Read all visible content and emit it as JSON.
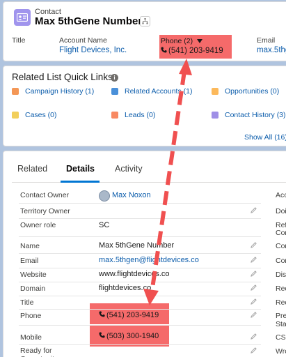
{
  "header": {
    "object_label": "Contact",
    "record_name": "Max 5thGene Number",
    "fields": [
      {
        "label": "Title",
        "value": ""
      },
      {
        "label": "Account Name",
        "value": "Flight Devices, Inc."
      },
      {
        "label": "Phone (2)",
        "value": "(541) 203-9419"
      },
      {
        "label": "Email",
        "value": "max.5thg"
      }
    ]
  },
  "quick_links": {
    "title": "Related List Quick Links",
    "items": [
      {
        "label": "Campaign History (1)",
        "color": "#f49756"
      },
      {
        "label": "Related Accounts (1)",
        "color": "#4a90d9"
      },
      {
        "label": "Opportunities (0)",
        "color": "#fcb95b"
      },
      {
        "label": "Cases (0)",
        "color": "#f2cf5b"
      },
      {
        "label": "Leads (0)",
        "color": "#f88962"
      },
      {
        "label": "Contact History (3)",
        "color": "#9f8fe6"
      }
    ],
    "show_all": "Show All (16)"
  },
  "tabs": [
    "Related",
    "Details",
    "Activity"
  ],
  "details": {
    "rows": [
      {
        "label": "Contact Owner",
        "value": "Max Noxon"
      },
      {
        "label": "Territory Owner",
        "value": ""
      },
      {
        "label": "Owner role",
        "value": "SC"
      },
      {
        "label": "Name",
        "value": "Max 5thGene Number"
      },
      {
        "label": "Email",
        "value": "max.5thgen@flightdevices.co"
      },
      {
        "label": "Website",
        "value": "www.flightdevices.co"
      },
      {
        "label": "Domain",
        "value": "flightdevices.co"
      },
      {
        "label": "Title",
        "value": ""
      },
      {
        "label": "Phone",
        "value": "(541) 203-9419"
      },
      {
        "label": "Mobile",
        "value": "(503) 300-1940"
      },
      {
        "label": "Ready for Opportunity",
        "value": ""
      }
    ],
    "right_labels": [
      "Acc",
      "Doi",
      "Refe",
      "Con",
      "Con",
      "Con",
      "Disc",
      "Reci",
      "Reci",
      "Prev",
      "Stat",
      "CSM",
      "Wro"
    ]
  },
  "colors": {
    "highlight": "#f56a6a",
    "link": "#0b5cab",
    "accent": "#0176d3",
    "contact_icon": "#a094ed"
  }
}
